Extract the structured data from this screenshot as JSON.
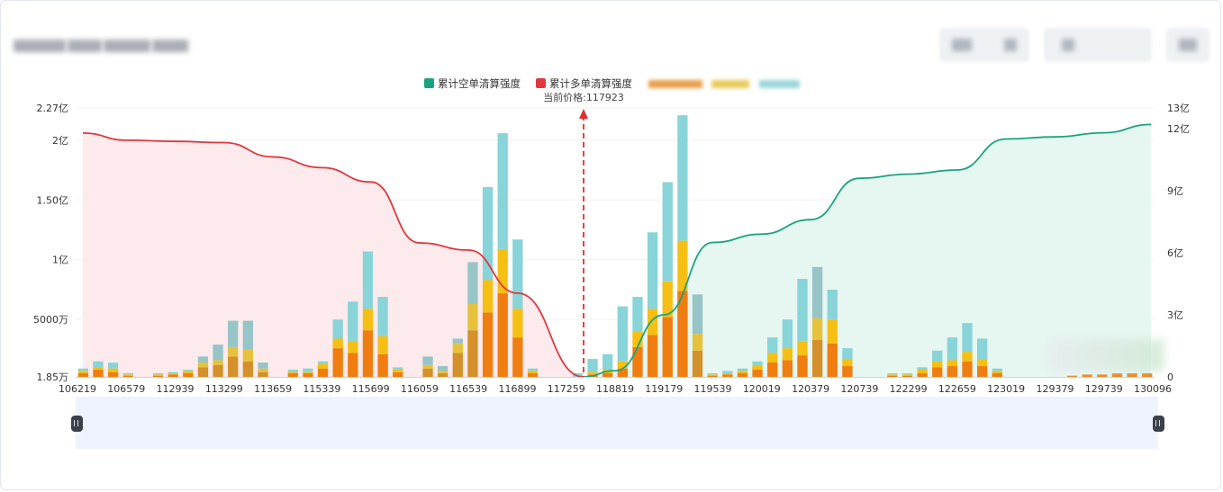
{
  "colors": {
    "short_line": "#1aa37f",
    "long_line": "#e0383e",
    "price_marker": "#e03030",
    "bar_orange": "#f07d10",
    "bar_yellow": "#f5bf14",
    "bar_teal": "#88d4d8",
    "bar_orange_muted": "#d4902a",
    "bar_yellow_muted": "#e6c23c",
    "bar_teal_muted": "#96c4c7"
  },
  "legend": {
    "short": "累计空单清算强度",
    "long": "累计多单清算强度"
  },
  "current_price_label": "当前价格:117923",
  "chart_data": {
    "type": "bar",
    "current_price": 117923,
    "x_tick_labels": [
      "106219",
      "106579",
      "112939",
      "113299",
      "113659",
      "115339",
      "115699",
      "116059",
      "116539",
      "116899",
      "117259",
      "118819",
      "119179",
      "119539",
      "120019",
      "120379",
      "120739",
      "122299",
      "122659",
      "123019",
      "129379",
      "129739",
      "130096"
    ],
    "y_left_ticks": [
      "1.85万",
      "5000万",
      "1亿",
      "1.50亿",
      "2亿",
      "2.27亿"
    ],
    "y_right_ticks": [
      "0",
      "3亿",
      "6亿",
      "9亿",
      "12亿",
      "13亿"
    ],
    "bar_values_left_axis": {
      "orange": [
        0.03,
        0.06,
        0.04,
        0.01,
        0,
        0.01,
        0.02,
        0.03,
        0.08,
        0.1,
        0.17,
        0.13,
        0.04,
        0,
        0.03,
        0.03,
        0.07,
        0.24,
        0.2,
        0.39,
        0.19,
        0.04,
        0,
        0.07,
        0.03,
        0.2,
        0.39,
        0.54,
        0.7,
        0.33,
        0.03,
        0,
        0,
        0,
        0.02,
        0.03,
        0.07,
        0.25,
        0.35,
        0.5,
        0.72,
        0.22,
        0.01,
        0.02,
        0.03,
        0.06,
        0.12,
        0.14,
        0.18,
        0.31,
        0.28,
        0.09,
        0,
        0,
        0.01,
        0.01,
        0.03,
        0.08,
        0.09,
        0.13,
        0.09,
        0.03,
        0,
        0,
        0,
        0,
        0.01,
        0.02,
        0.02,
        0.03,
        0.03,
        0.03
      ],
      "yellow": [
        0.02,
        0.02,
        0.03,
        0.01,
        0,
        0.01,
        0.01,
        0.02,
        0.04,
        0.04,
        0.08,
        0.1,
        0.03,
        0,
        0.01,
        0.01,
        0.04,
        0.08,
        0.1,
        0.18,
        0.15,
        0.02,
        0,
        0.03,
        0.02,
        0.08,
        0.22,
        0.27,
        0.37,
        0.24,
        0.02,
        0,
        0,
        0,
        0.02,
        0.03,
        0.06,
        0.13,
        0.22,
        0.3,
        0.42,
        0.14,
        0.01,
        0.01,
        0.02,
        0.04,
        0.08,
        0.1,
        0.12,
        0.18,
        0.2,
        0.06,
        0,
        0,
        0.01,
        0.01,
        0.03,
        0.05,
        0.05,
        0.08,
        0.06,
        0.02,
        0,
        0,
        0,
        0,
        0,
        0,
        0,
        0,
        0,
        0
      ],
      "teal": [
        0.02,
        0.05,
        0.05,
        0.01,
        0,
        0.01,
        0.01,
        0.01,
        0.05,
        0.13,
        0.22,
        0.24,
        0.05,
        0,
        0.02,
        0.03,
        0.02,
        0.16,
        0.33,
        0.48,
        0.33,
        0.02,
        0,
        0.07,
        0.04,
        0.04,
        0.35,
        0.78,
        0.97,
        0.58,
        0.02,
        0,
        0,
        0.03,
        0.11,
        0.13,
        0.46,
        0.29,
        0.64,
        0.83,
        1.05,
        0.33,
        0.01,
        0.02,
        0.02,
        0.03,
        0.13,
        0.24,
        0.52,
        0.43,
        0.25,
        0.09,
        0,
        0,
        0.01,
        0.01,
        0.02,
        0.09,
        0.19,
        0.24,
        0.17,
        0.02,
        0,
        0,
        0,
        0,
        0,
        0,
        0,
        0,
        0,
        0
      ]
    },
    "series": [
      {
        "name": "累计多单清算强度",
        "x": [
          106219,
          106579,
          112939,
          113299,
          113659,
          115339,
          115699,
          116059,
          116539,
          116899,
          117259
        ],
        "y_left": [
          2.06,
          2.0,
          1.99,
          1.98,
          1.86,
          1.77,
          1.65,
          1.14,
          1.08,
          0.72,
          0.0185
        ]
      },
      {
        "name": "累计空单清算强度",
        "x": [
          118819,
          119179,
          119539,
          120019,
          120379,
          120739,
          122299,
          122659,
          123019,
          129379,
          129739,
          130096
        ],
        "y_right": [
          0.3,
          3.0,
          6.5,
          6.9,
          7.6,
          9.6,
          9.8,
          10.0,
          11.5,
          11.6,
          11.8,
          12.2
        ]
      }
    ],
    "ylim_left": [
      0.0185,
      2.27
    ],
    "ylim_right": [
      0,
      13
    ],
    "grid": true,
    "legend_position": "top-center"
  }
}
